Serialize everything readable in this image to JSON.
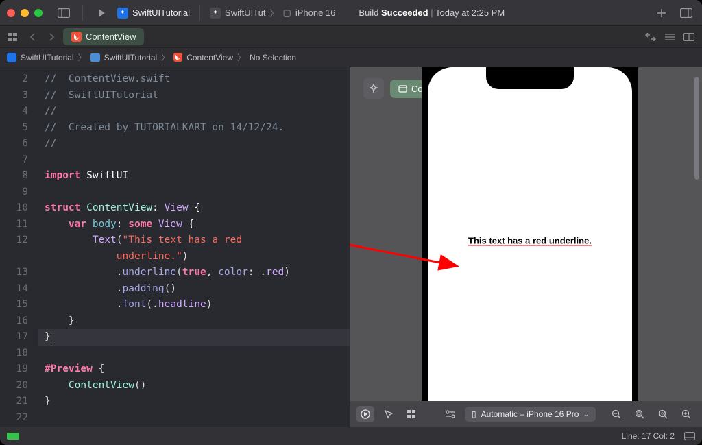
{
  "window": {
    "project": "SwiftUITutorial",
    "scheme_left": "SwiftUITut",
    "device": "iPhone 16",
    "build_status_label": "Build",
    "build_status_result": "Succeeded",
    "build_status_time": "Today at 2:25 PM"
  },
  "tab": {
    "filename": "ContentView"
  },
  "breadcrumb": {
    "project": "SwiftUITutorial",
    "folder": "SwiftUITutorial",
    "file": "ContentView",
    "selection": "No Selection"
  },
  "code": {
    "lines": [
      {
        "n": 2,
        "html": "<span class='tok-comment'>//  ContentView.swift</span>"
      },
      {
        "n": 3,
        "html": "<span class='tok-comment'>//  SwiftUITutorial</span>"
      },
      {
        "n": 4,
        "html": "<span class='tok-comment'>//</span>"
      },
      {
        "n": 5,
        "html": "<span class='tok-comment'>//  Created by TUTORIALKART on 14/12/24.</span>"
      },
      {
        "n": 6,
        "html": "<span class='tok-comment'>//</span>"
      },
      {
        "n": 7,
        "html": ""
      },
      {
        "n": 8,
        "html": "<span class='tok-kw'>import</span> <span style='color:#fff'>SwiftUI</span>"
      },
      {
        "n": 9,
        "html": ""
      },
      {
        "n": 10,
        "html": "<span class='tok-kw'>struct</span> <span class='tok-name'>ContentView</span><span style='color:#fff'>:</span> <span class='tok-type2'>View</span> <span style='color:#fff'>{</span>"
      },
      {
        "n": 11,
        "html": "    <span class='tok-kw'>var</span> <span class='tok-prop'>body</span><span style='color:#fff'>:</span> <span class='tok-kw'>some</span> <span class='tok-type2'>View</span> <span style='color:#fff'>{</span>"
      },
      {
        "n": 12,
        "html": "        <span class='tok-type2'>Text</span>(<span class='tok-str'>\"This text has a red </span>\n            <span class='tok-str'>underline.\"</span>)"
      },
      {
        "n": 13,
        "html": "            .<span class='tok-call'>underline</span>(<span class='tok-kw'>true</span>, <span class='tok-call'>color</span>: .<span class='tok-attr'>red</span>)"
      },
      {
        "n": 14,
        "html": "            .<span class='tok-call'>padding</span>()"
      },
      {
        "n": 15,
        "html": "            .<span class='tok-call'>font</span>(.<span class='tok-attr'>headline</span>)"
      },
      {
        "n": 16,
        "html": "    }"
      },
      {
        "n": 17,
        "html": "}<span class='cursor'></span>"
      },
      {
        "n": 18,
        "html": ""
      },
      {
        "n": 19,
        "html": "<span class='tok-kw'>#Preview</span> {"
      },
      {
        "n": 20,
        "html": "    <span class='tok-name'>ContentView</span>()"
      },
      {
        "n": 21,
        "html": "}"
      },
      {
        "n": 22,
        "html": ""
      }
    ],
    "highlighted_line": 17
  },
  "preview": {
    "chip": "ContentView",
    "rendered_text": "This text has a red underline.",
    "device_picker": "Automatic – iPhone 16 Pro"
  },
  "statusbar": {
    "pos": "Line: 17  Col: 2"
  }
}
